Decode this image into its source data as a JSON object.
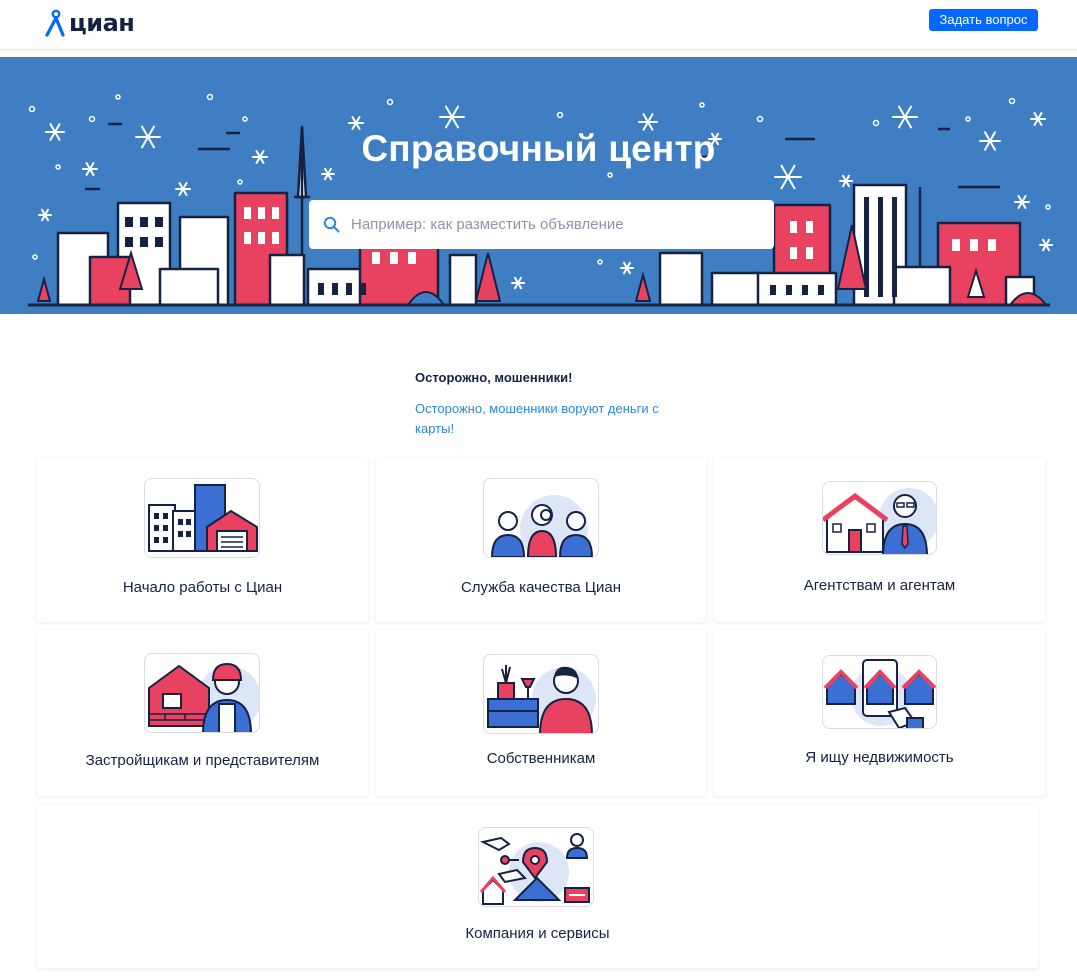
{
  "header": {
    "logo_text": "циан",
    "ask_button": "Задать вопрос"
  },
  "hero": {
    "title": "Справочный центр",
    "search_placeholder": "Например: как разместить объявление"
  },
  "warning": {
    "title": "Осторожно, мошенники!",
    "link": "Осторожно, мошенники воруют деньги с карты!"
  },
  "categories": [
    {
      "label": "Начало работы с Циан",
      "icon": "buildings-icon"
    },
    {
      "label": "Служба качества Циан",
      "icon": "quality-team-icon"
    },
    {
      "label": "Агентствам и агентам",
      "icon": "agent-icon"
    },
    {
      "label": "Застройщикам и представителям",
      "icon": "builder-icon"
    },
    {
      "label": "Собственникам",
      "icon": "owner-icon"
    },
    {
      "label": "Я ищу недвижимость",
      "icon": "phone-search-icon"
    },
    {
      "label": "Компания и сервисы",
      "icon": "company-services-icon"
    }
  ],
  "colors": {
    "brand_blue": "#0468ff",
    "hero_blue": "#3f7ec3",
    "link_blue": "#2b87db",
    "accent_red": "#e84260",
    "text_dark": "#152242"
  }
}
